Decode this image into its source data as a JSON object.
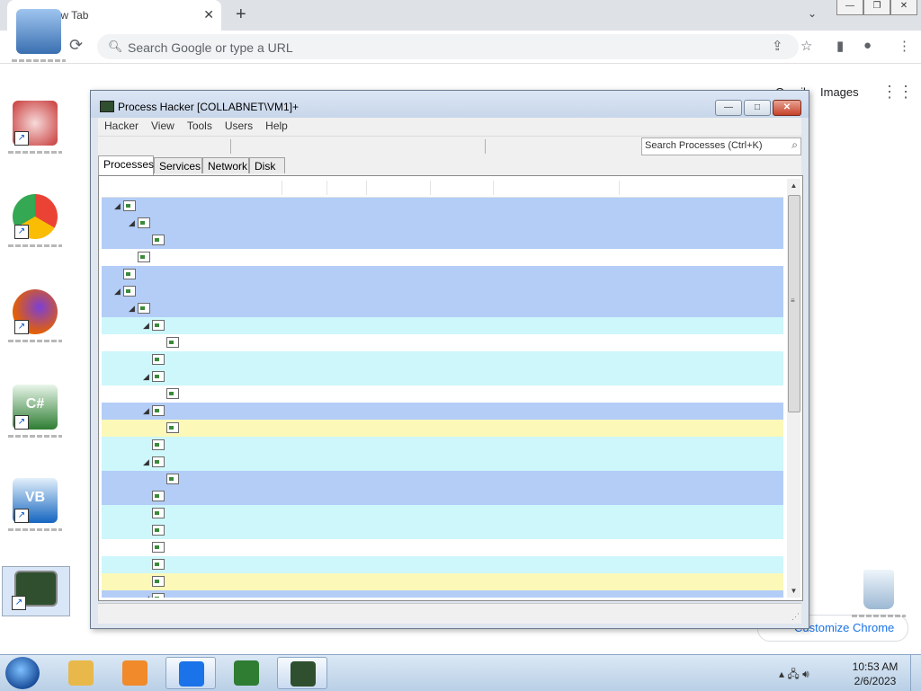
{
  "browser": {
    "tab_title": "New Tab",
    "tab_close": "✕",
    "new_tab": "+",
    "tab_search": "⌄",
    "window_controls": [
      "—",
      "❐",
      "✕"
    ],
    "omnibox_placeholder": "Search Google or type a URL",
    "gmail_link": "Gmail",
    "images_link": "Images",
    "customize_label": "Customize Chrome"
  },
  "desktop_icons": [
    {
      "name": "process-icon",
      "color": "#c83a3a"
    },
    {
      "name": "chrome-icon",
      "color": "#1a73e8"
    },
    {
      "name": "firefox-icon",
      "color": "#e66000"
    },
    {
      "name": "csharp-icon",
      "color": "#2e7d32"
    },
    {
      "name": "vb-icon",
      "color": "#1565c0"
    },
    {
      "name": "process-hacker-icon",
      "color": "#2f4f2f"
    }
  ],
  "process_hacker": {
    "title": "Process Hacker [COLLABNET\\VM1]+",
    "menu": [
      "Hacker",
      "View",
      "Tools",
      "Users",
      "Help"
    ],
    "search_placeholder": "Search Processes (Ctrl+K)",
    "tabs": [
      "Processes",
      "Services",
      "Network",
      "Disk"
    ],
    "active_tab": "Processes",
    "rows": [
      {
        "depth": 1,
        "expanded": true,
        "color": "#b3cdf7"
      },
      {
        "depth": 2,
        "expanded": true,
        "color": "#b3cdf7"
      },
      {
        "depth": 3,
        "expanded": false,
        "color": "#b3cdf7"
      },
      {
        "depth": 2,
        "expanded": false,
        "color": "#ffffff"
      },
      {
        "depth": 1,
        "expanded": false,
        "color": "#b3cdf7"
      },
      {
        "depth": 1,
        "expanded": true,
        "color": "#b3cdf7"
      },
      {
        "depth": 2,
        "expanded": true,
        "color": "#b3cdf7"
      },
      {
        "depth": 3,
        "expanded": true,
        "color": "#cdf7fb"
      },
      {
        "depth": 4,
        "expanded": false,
        "color": "#ffffff"
      },
      {
        "depth": 3,
        "expanded": false,
        "color": "#cdf7fb"
      },
      {
        "depth": 3,
        "expanded": true,
        "color": "#cdf7fb"
      },
      {
        "depth": 4,
        "expanded": false,
        "color": "#ffffff"
      },
      {
        "depth": 3,
        "expanded": true,
        "color": "#b3cdf7"
      },
      {
        "depth": 4,
        "expanded": false,
        "color": "#fcf8b8"
      },
      {
        "depth": 3,
        "expanded": false,
        "color": "#cdf7fb"
      },
      {
        "depth": 3,
        "expanded": true,
        "color": "#cdf7fb"
      },
      {
        "depth": 4,
        "expanded": false,
        "color": "#b3cdf7"
      },
      {
        "depth": 3,
        "expanded": false,
        "color": "#b3cdf7"
      },
      {
        "depth": 3,
        "expanded": false,
        "color": "#cdf7fb"
      },
      {
        "depth": 3,
        "expanded": false,
        "color": "#cdf7fb"
      },
      {
        "depth": 3,
        "expanded": false,
        "color": "#ffffff"
      },
      {
        "depth": 3,
        "expanded": false,
        "color": "#cdf7fb"
      },
      {
        "depth": 3,
        "expanded": false,
        "color": "#fcf8b8"
      },
      {
        "depth": 3,
        "expanded": true,
        "color": "#b3cdf7"
      }
    ]
  },
  "taskbar": {
    "items": [
      {
        "name": "explorer-taskbar-icon",
        "color": "#e8b84a",
        "active": false
      },
      {
        "name": "media-player-taskbar-icon",
        "color": "#f08a2a",
        "active": false
      },
      {
        "name": "chrome-taskbar-icon",
        "color": "#1a73e8",
        "active": true
      },
      {
        "name": "csharp-taskbar-icon",
        "color": "#2e7d32",
        "active": false
      },
      {
        "name": "process-hacker-taskbar-icon",
        "color": "#2f4f2f",
        "active": true
      }
    ],
    "time": "10:53 AM",
    "date": "2/6/2023"
  }
}
